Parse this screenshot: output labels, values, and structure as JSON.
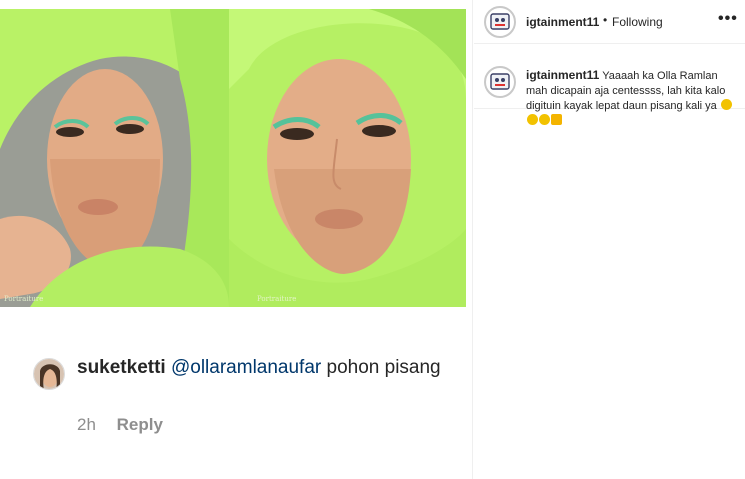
{
  "header": {
    "username": "igtainment11",
    "separator": "•",
    "follow_status": "Following",
    "more_label": "•••"
  },
  "caption": {
    "username": "igtainment11",
    "text": "Yaaaah ka Olla Ramlan mah dicapain aja centessss, lah kita kalo digituin kayak lepat daun pisang kali ya",
    "emojis": [
      "crying-face-emoji",
      "crying-face-emoji",
      "crying-face-emoji",
      "ok-hand-emoji"
    ]
  },
  "media": {
    "watermark_left": "Portraiture",
    "watermark_right": "Portraiture"
  },
  "comment": {
    "username": "suketketti",
    "mention": "@ollaramlanaufar",
    "text": " pohon pisang",
    "time": "2h",
    "reply_label": "Reply"
  },
  "colors": {
    "scarf_green": "#b8f060",
    "background_grey": "#9a9a94",
    "skin": "#e0aa85",
    "link": "#00376b",
    "text": "#262626",
    "muted": "#8e8e8e"
  }
}
